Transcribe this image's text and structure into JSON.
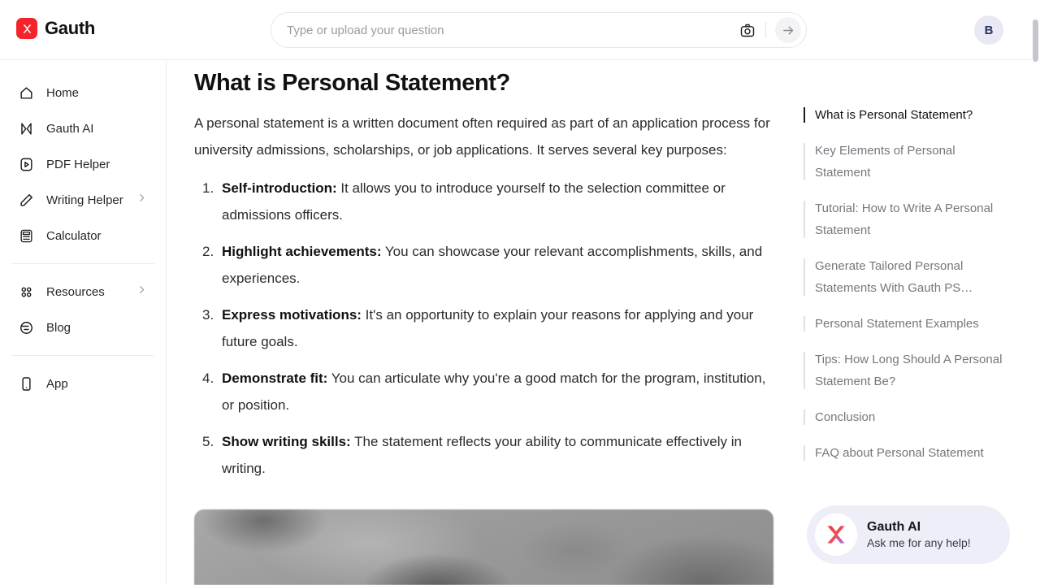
{
  "header": {
    "brand_name": "Gauth",
    "brand_icon": "gauth-logo-icon",
    "search": {
      "placeholder": "Type or upload your question",
      "value": "",
      "camera_icon": "camera-icon",
      "submit_icon": "arrow-right-icon"
    },
    "avatar_initial": "B"
  },
  "sidebar": {
    "groups": [
      {
        "items": [
          {
            "label": "Home",
            "icon": "home-icon",
            "chevron": false
          },
          {
            "label": "Gauth AI",
            "icon": "gauth-ai-icon",
            "chevron": false
          },
          {
            "label": "PDF Helper",
            "icon": "pdf-icon",
            "chevron": false
          },
          {
            "label": "Writing Helper",
            "icon": "pen-icon",
            "chevron": true
          },
          {
            "label": "Calculator",
            "icon": "calculator-icon",
            "chevron": false
          }
        ]
      },
      {
        "items": [
          {
            "label": "Resources",
            "icon": "grid-icon",
            "chevron": true
          },
          {
            "label": "Blog",
            "icon": "blog-icon",
            "chevron": false
          }
        ]
      },
      {
        "items": [
          {
            "label": "App",
            "icon": "phone-icon",
            "chevron": false
          }
        ]
      }
    ]
  },
  "article": {
    "title": "What is Personal Statement?",
    "intro": "A personal statement is a written document often required as part of an application process for university admissions, scholarships, or job applications. It serves several key purposes:",
    "list": [
      {
        "term": "Self-introduction:",
        "text": " It allows you to introduce yourself to the selection committee or admissions officers."
      },
      {
        "term": "Highlight achievements:",
        "text": " You can showcase your relevant accomplishments, skills, and experiences."
      },
      {
        "term": "Express motivations:",
        "text": " It's an opportunity to explain your reasons for applying and your future goals."
      },
      {
        "term": "Demonstrate fit:",
        "text": " You can articulate why you're a good match for the program, institution, or position."
      },
      {
        "term": "Show writing skills:",
        "text": " The statement reflects your ability to communicate effectively in writing."
      }
    ],
    "image_alt": "article-hero-image"
  },
  "toc": {
    "items": [
      {
        "label": "What is Personal Statement?",
        "active": true
      },
      {
        "label": "Key Elements of Personal Statement",
        "active": false
      },
      {
        "label": "Tutorial: How to Write A Personal Statement",
        "active": false
      },
      {
        "label": "Generate Tailored Personal Statements With Gauth PS…",
        "active": false
      },
      {
        "label": "Personal Statement Examples",
        "active": false
      },
      {
        "label": "Tips: How Long Should A Personal Statement Be?",
        "active": false
      },
      {
        "label": "Conclusion",
        "active": false
      },
      {
        "label": "FAQ about Personal Statement",
        "active": false
      }
    ]
  },
  "chat_widget": {
    "title": "Gauth AI",
    "subtitle": "Ask me for any help!",
    "icon": "gauth-logo-icon"
  },
  "colors": {
    "brand_red": "#f5232a",
    "accent_active": "#1b1b1f",
    "toc_inactive": "#76767e",
    "widget_bg": "#eeeef8",
    "avatar_bg": "#e8e9f4"
  }
}
